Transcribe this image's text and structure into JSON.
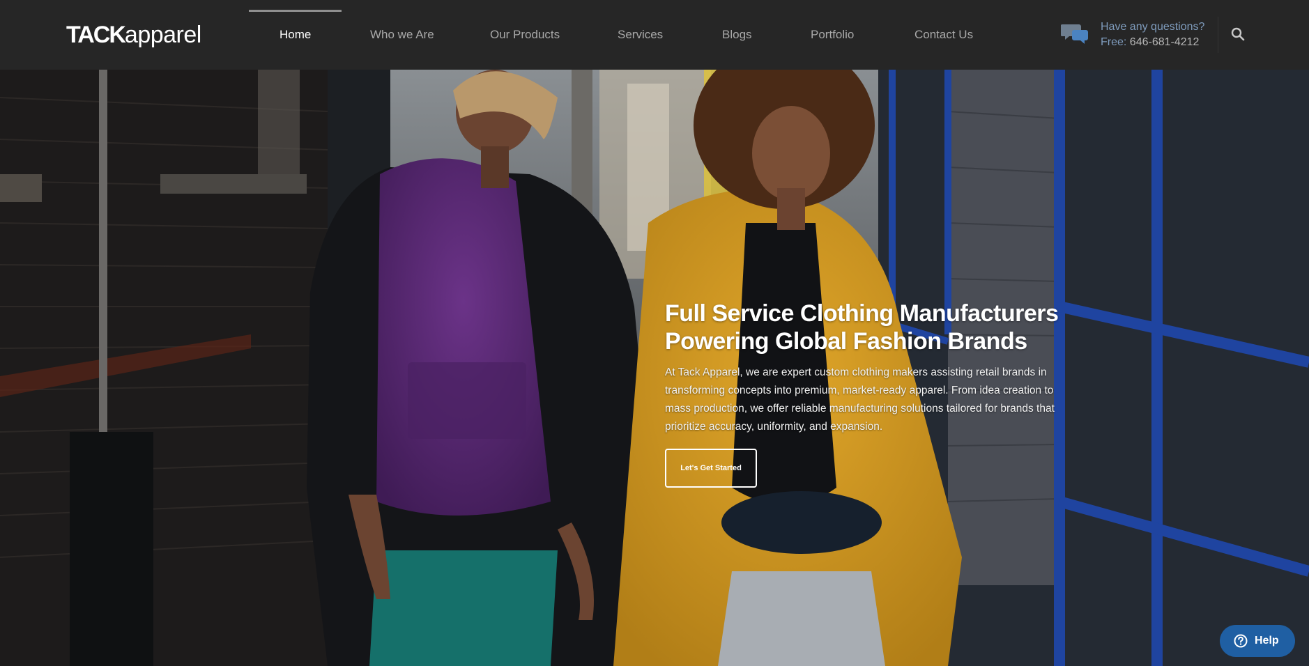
{
  "header": {
    "logo": {
      "bold": "TACK",
      "light": "apparel"
    },
    "nav": [
      {
        "label": "Home",
        "active": true
      },
      {
        "label": "Who we Are",
        "active": false
      },
      {
        "label": "Our Products",
        "active": false
      },
      {
        "label": "Services",
        "active": false
      },
      {
        "label": "Blogs",
        "active": false
      },
      {
        "label": "Portfolio",
        "active": false
      },
      {
        "label": "Contact Us",
        "active": false
      }
    ],
    "contact": {
      "question": "Have any questions?",
      "phone_label": "Free:",
      "phone": "646-681-4212",
      "icon": "chat-bubbles-icon"
    },
    "search_icon": "search-icon"
  },
  "hero": {
    "title_line1": "Full Service Clothing Manufacturers",
    "title_line2": "Powering Global Fashion Brands",
    "description": "At Tack Apparel, we are expert custom clothing makers assisting retail brands in transforming concepts into premium, market-ready apparel. From idea creation to mass production, we offer reliable manufacturing solutions tailored for brands that prioritize accuracy, uniformity, and expansion.",
    "cta_label": "Let's Get Started",
    "image_subject": "two models walking down a brick alley, one in a purple hoodie and one in a yellow fluffy coat"
  },
  "help": {
    "label": "Help",
    "icon": "question-circle-icon"
  },
  "colors": {
    "header_bg": "#262626",
    "nav_active": "#ffffff",
    "nav_inactive": "#a9a9a9",
    "contact_accent": "#7f9cbd",
    "help_bg": "#1f5fa3",
    "hoodie_purple": "#5b2a78",
    "coat_yellow": "#d49a21"
  }
}
